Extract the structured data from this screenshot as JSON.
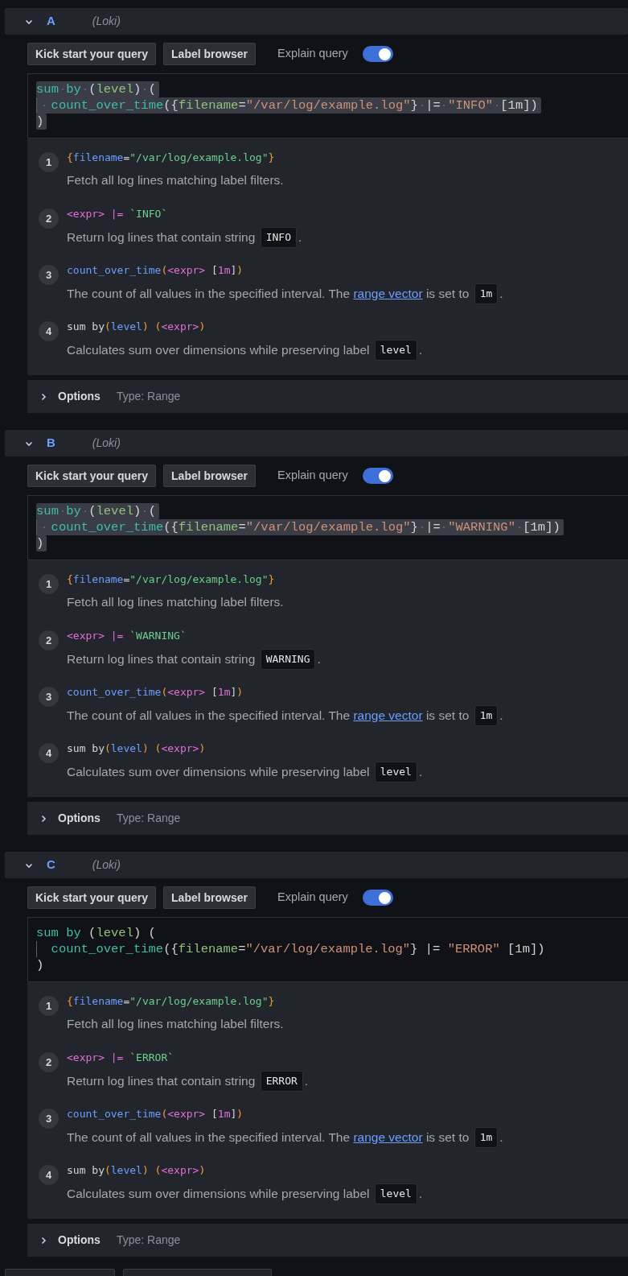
{
  "queries": [
    {
      "letter": "A",
      "datasource": "(Loki)",
      "expanded": true,
      "buttons": [
        "Kick start your query",
        "Label browser"
      ],
      "explain": {
        "label": "Explain query",
        "on": true
      },
      "editor": {
        "selected": true,
        "lines": [
          {
            "indent": false,
            "tokens": [
              {
                "kind": "kw",
                "text": "sum by"
              },
              {
                "kind": "plain",
                "text": " ("
              },
              {
                "kind": "label",
                "text": "level"
              },
              {
                "kind": "plain",
                "text": ") ("
              }
            ]
          },
          {
            "indent": true,
            "tokens": [
              {
                "kind": "kw",
                "text": "count_over_time"
              },
              {
                "kind": "plain",
                "text": "({"
              },
              {
                "kind": "label",
                "text": "filename"
              },
              {
                "kind": "plain",
                "text": "="
              },
              {
                "kind": "str",
                "text": "\"/var/log/example.log\""
              },
              {
                "kind": "plain",
                "text": "} |= "
              },
              {
                "kind": "str",
                "text": "\"INFO\""
              },
              {
                "kind": "plain",
                "text": " [1m])"
              }
            ]
          },
          {
            "indent": false,
            "tokens": [
              {
                "kind": "plain",
                "text": ")"
              }
            ]
          }
        ]
      },
      "steps": [
        {
          "number": "1",
          "code": [
            {
              "kind": "brace",
              "text": "{"
            },
            {
              "kind": "name",
              "text": "filename"
            },
            {
              "kind": "plain",
              "text": "="
            },
            {
              "kind": "green",
              "text": "\"/var/log/example.log\""
            },
            {
              "kind": "brace",
              "text": "}"
            }
          ],
          "description": [
            {
              "kind": "text",
              "text": "Fetch all log lines matching label filters."
            }
          ]
        },
        {
          "number": "2",
          "code": [
            {
              "kind": "expr",
              "text": "<expr> |="
            },
            {
              "kind": "green",
              "text": " `INFO`"
            }
          ],
          "description": [
            {
              "kind": "text",
              "text": "Return log lines that contain string "
            },
            {
              "kind": "code",
              "text": "INFO"
            },
            {
              "kind": "text",
              "text": "."
            }
          ]
        },
        {
          "number": "3",
          "code": [
            {
              "kind": "name",
              "text": "count_over_time"
            },
            {
              "kind": "brace",
              "text": "("
            },
            {
              "kind": "expr",
              "text": "<expr>"
            },
            {
              "kind": "plain",
              "text": " ["
            },
            {
              "kind": "expr",
              "text": "1m"
            },
            {
              "kind": "plain",
              "text": "]"
            },
            {
              "kind": "brace",
              "text": ")"
            }
          ],
          "description": [
            {
              "kind": "text",
              "text": "The count of all values in the specified interval. The "
            },
            {
              "kind": "link",
              "text": "range vector"
            },
            {
              "kind": "text",
              "text": " is set to "
            },
            {
              "kind": "code",
              "text": "1m"
            },
            {
              "kind": "text",
              "text": "."
            }
          ]
        },
        {
          "number": "4",
          "code": [
            {
              "kind": "plain",
              "text": "sum by"
            },
            {
              "kind": "brace",
              "text": "("
            },
            {
              "kind": "name",
              "text": "level"
            },
            {
              "kind": "brace",
              "text": ") ("
            },
            {
              "kind": "expr",
              "text": "<expr>"
            },
            {
              "kind": "brace",
              "text": ")"
            }
          ],
          "description": [
            {
              "kind": "text",
              "text": "Calculates sum over dimensions while preserving label "
            },
            {
              "kind": "code",
              "text": "level"
            },
            {
              "kind": "text",
              "text": "."
            }
          ]
        }
      ],
      "options": {
        "label": "Options",
        "type": "Type: Range",
        "expanded": false
      }
    },
    {
      "letter": "B",
      "datasource": "(Loki)",
      "expanded": true,
      "buttons": [
        "Kick start your query",
        "Label browser"
      ],
      "explain": {
        "label": "Explain query",
        "on": true
      },
      "editor": {
        "selected": true,
        "lines": [
          {
            "indent": false,
            "tokens": [
              {
                "kind": "kw",
                "text": "sum by"
              },
              {
                "kind": "plain",
                "text": " ("
              },
              {
                "kind": "label",
                "text": "level"
              },
              {
                "kind": "plain",
                "text": ") ("
              }
            ]
          },
          {
            "indent": true,
            "tokens": [
              {
                "kind": "kw",
                "text": "count_over_time"
              },
              {
                "kind": "plain",
                "text": "({"
              },
              {
                "kind": "label",
                "text": "filename"
              },
              {
                "kind": "plain",
                "text": "="
              },
              {
                "kind": "str",
                "text": "\"/var/log/example.log\""
              },
              {
                "kind": "plain",
                "text": "} |= "
              },
              {
                "kind": "str",
                "text": "\"WARNING\""
              },
              {
                "kind": "plain",
                "text": " [1m])"
              }
            ]
          },
          {
            "indent": false,
            "tokens": [
              {
                "kind": "plain",
                "text": ")"
              }
            ]
          }
        ]
      },
      "steps": [
        {
          "number": "1",
          "code": [
            {
              "kind": "brace",
              "text": "{"
            },
            {
              "kind": "name",
              "text": "filename"
            },
            {
              "kind": "plain",
              "text": "="
            },
            {
              "kind": "green",
              "text": "\"/var/log/example.log\""
            },
            {
              "kind": "brace",
              "text": "}"
            }
          ],
          "description": [
            {
              "kind": "text",
              "text": "Fetch all log lines matching label filters."
            }
          ]
        },
        {
          "number": "2",
          "code": [
            {
              "kind": "expr",
              "text": "<expr> |="
            },
            {
              "kind": "green",
              "text": " `WARNING`"
            }
          ],
          "description": [
            {
              "kind": "text",
              "text": "Return log lines that contain string "
            },
            {
              "kind": "code",
              "text": "WARNING"
            },
            {
              "kind": "text",
              "text": "."
            }
          ]
        },
        {
          "number": "3",
          "code": [
            {
              "kind": "name",
              "text": "count_over_time"
            },
            {
              "kind": "brace",
              "text": "("
            },
            {
              "kind": "expr",
              "text": "<expr>"
            },
            {
              "kind": "plain",
              "text": " ["
            },
            {
              "kind": "expr",
              "text": "1m"
            },
            {
              "kind": "plain",
              "text": "]"
            },
            {
              "kind": "brace",
              "text": ")"
            }
          ],
          "description": [
            {
              "kind": "text",
              "text": "The count of all values in the specified interval. The "
            },
            {
              "kind": "link",
              "text": "range vector"
            },
            {
              "kind": "text",
              "text": " is set to "
            },
            {
              "kind": "code",
              "text": "1m"
            },
            {
              "kind": "text",
              "text": "."
            }
          ]
        },
        {
          "number": "4",
          "code": [
            {
              "kind": "plain",
              "text": "sum by"
            },
            {
              "kind": "brace",
              "text": "("
            },
            {
              "kind": "name",
              "text": "level"
            },
            {
              "kind": "brace",
              "text": ") ("
            },
            {
              "kind": "expr",
              "text": "<expr>"
            },
            {
              "kind": "brace",
              "text": ")"
            }
          ],
          "description": [
            {
              "kind": "text",
              "text": "Calculates sum over dimensions while preserving label "
            },
            {
              "kind": "code",
              "text": "level"
            },
            {
              "kind": "text",
              "text": "."
            }
          ]
        }
      ],
      "options": {
        "label": "Options",
        "type": "Type: Range",
        "expanded": false
      }
    },
    {
      "letter": "C",
      "datasource": "(Loki)",
      "expanded": true,
      "buttons": [
        "Kick start your query",
        "Label browser"
      ],
      "explain": {
        "label": "Explain query",
        "on": true
      },
      "editor": {
        "selected": false,
        "lines": [
          {
            "indent": false,
            "tokens": [
              {
                "kind": "kw",
                "text": "sum by"
              },
              {
                "kind": "plain",
                "text": " ("
              },
              {
                "kind": "label",
                "text": "level"
              },
              {
                "kind": "plain",
                "text": ") ("
              }
            ]
          },
          {
            "indent": true,
            "tokens": [
              {
                "kind": "kw",
                "text": "count_over_time"
              },
              {
                "kind": "plain",
                "text": "({"
              },
              {
                "kind": "label",
                "text": "filename"
              },
              {
                "kind": "plain",
                "text": "="
              },
              {
                "kind": "str",
                "text": "\"/var/log/example.log\""
              },
              {
                "kind": "plain",
                "text": "} |= "
              },
              {
                "kind": "str",
                "text": "\"ERROR\""
              },
              {
                "kind": "plain",
                "text": " [1m])"
              }
            ]
          },
          {
            "indent": false,
            "tokens": [
              {
                "kind": "plain",
                "text": ")"
              }
            ]
          }
        ]
      },
      "steps": [
        {
          "number": "1",
          "code": [
            {
              "kind": "brace",
              "text": "{"
            },
            {
              "kind": "name",
              "text": "filename"
            },
            {
              "kind": "plain",
              "text": "="
            },
            {
              "kind": "green",
              "text": "\"/var/log/example.log\""
            },
            {
              "kind": "brace",
              "text": "}"
            }
          ],
          "description": [
            {
              "kind": "text",
              "text": "Fetch all log lines matching label filters."
            }
          ]
        },
        {
          "number": "2",
          "code": [
            {
              "kind": "expr",
              "text": "<expr> |="
            },
            {
              "kind": "green",
              "text": " `ERROR`"
            }
          ],
          "description": [
            {
              "kind": "text",
              "text": "Return log lines that contain string "
            },
            {
              "kind": "code",
              "text": "ERROR"
            },
            {
              "kind": "text",
              "text": "."
            }
          ]
        },
        {
          "number": "3",
          "code": [
            {
              "kind": "name",
              "text": "count_over_time"
            },
            {
              "kind": "brace",
              "text": "("
            },
            {
              "kind": "expr",
              "text": "<expr>"
            },
            {
              "kind": "plain",
              "text": " ["
            },
            {
              "kind": "expr",
              "text": "1m"
            },
            {
              "kind": "plain",
              "text": "]"
            },
            {
              "kind": "brace",
              "text": ")"
            }
          ],
          "description": [
            {
              "kind": "text",
              "text": "The count of all values in the specified interval. The "
            },
            {
              "kind": "link",
              "text": "range vector"
            },
            {
              "kind": "text",
              "text": " is set to "
            },
            {
              "kind": "code",
              "text": "1m"
            },
            {
              "kind": "text",
              "text": "."
            }
          ]
        },
        {
          "number": "4",
          "code": [
            {
              "kind": "plain",
              "text": "sum by"
            },
            {
              "kind": "brace",
              "text": "("
            },
            {
              "kind": "name",
              "text": "level"
            },
            {
              "kind": "brace",
              "text": ") ("
            },
            {
              "kind": "expr",
              "text": "<expr>"
            },
            {
              "kind": "brace",
              "text": ")"
            }
          ],
          "description": [
            {
              "kind": "text",
              "text": "Calculates sum over dimensions while preserving label "
            },
            {
              "kind": "code",
              "text": "level"
            },
            {
              "kind": "text",
              "text": "."
            }
          ]
        }
      ],
      "options": {
        "label": "Options",
        "type": "Type: Range",
        "expanded": false
      }
    }
  ]
}
